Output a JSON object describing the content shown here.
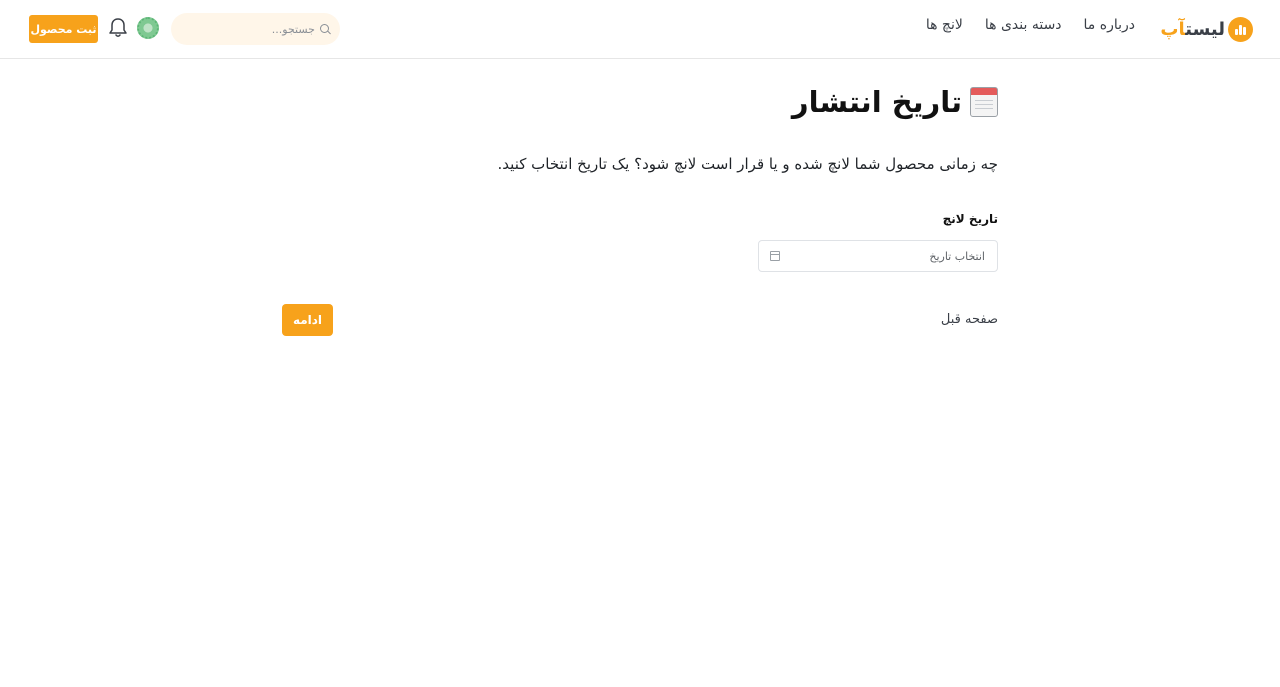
{
  "header": {
    "logo": {
      "text_dark": "لیست",
      "text_accent": "آپ",
      "icon": "chart-bubble-icon"
    },
    "nav": [
      {
        "label": "لانچ ها"
      },
      {
        "label": "دسته بندی ها"
      },
      {
        "label": "درباره ما"
      }
    ],
    "search": {
      "placeholder": "جستجو...",
      "icon": "search-icon"
    },
    "avatar_icon": "avatar",
    "notifications_icon": "bell-icon",
    "submit_label": "ثبت محصول"
  },
  "main": {
    "title_icon": "calendar-icon",
    "title": "تاریخ انتشار",
    "subtitle": "چه زمانی محصول شما لانچ شده و یا قرار است لانچ شود؟ یک تاریخ انتخاب کنید.",
    "field_label": "تاریخ لانچ",
    "date_placeholder": "انتخاب تاریخ",
    "prev_label": "صفحه قبل",
    "continue_label": "ادامه"
  },
  "colors": {
    "accent": "#f7a21b",
    "search_bg": "#fff6e9",
    "text": "#1f2328"
  }
}
